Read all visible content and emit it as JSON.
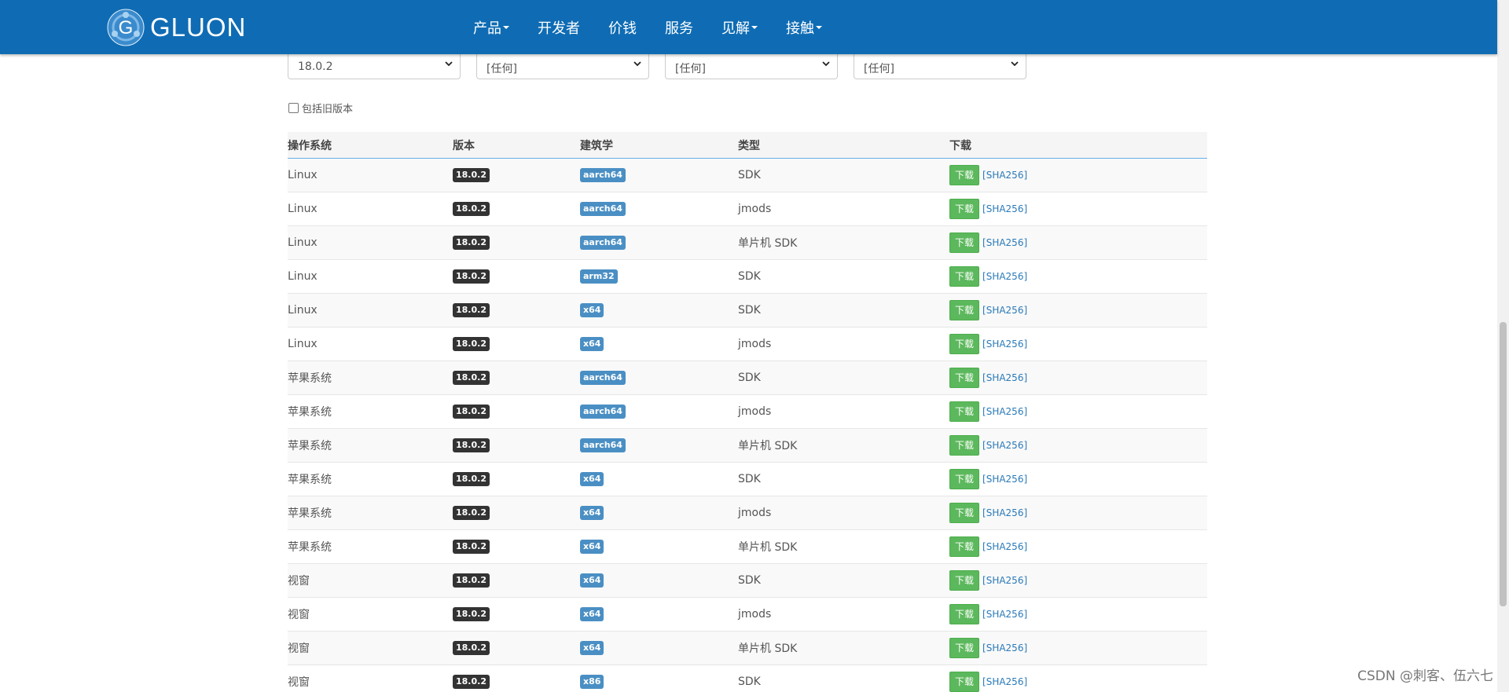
{
  "brand": {
    "name": "GLUON"
  },
  "nav": [
    {
      "label": "产品",
      "dropdown": true
    },
    {
      "label": "开发者",
      "dropdown": false
    },
    {
      "label": "价钱",
      "dropdown": false
    },
    {
      "label": "服务",
      "dropdown": false
    },
    {
      "label": "见解",
      "dropdown": true
    },
    {
      "label": "接触",
      "dropdown": true
    }
  ],
  "filters": {
    "version": "18.0.2",
    "os": "[任何]",
    "arch": "[任何]",
    "type": "[任何]"
  },
  "include_old_label": "包括旧版本",
  "table": {
    "headers": {
      "os": "操作系统",
      "version": "版本",
      "arch": "建筑学",
      "type": "类型",
      "download": "下载"
    },
    "download_label": "下载",
    "sha_label": "[SHA256]",
    "rows": [
      {
        "os": "Linux",
        "version": "18.0.2",
        "arch": "aarch64",
        "type": "SDK"
      },
      {
        "os": "Linux",
        "version": "18.0.2",
        "arch": "aarch64",
        "type": "jmods"
      },
      {
        "os": "Linux",
        "version": "18.0.2",
        "arch": "aarch64",
        "type": "单片机 SDK"
      },
      {
        "os": "Linux",
        "version": "18.0.2",
        "arch": "arm32",
        "type": "SDK"
      },
      {
        "os": "Linux",
        "version": "18.0.2",
        "arch": "x64",
        "type": "SDK"
      },
      {
        "os": "Linux",
        "version": "18.0.2",
        "arch": "x64",
        "type": "jmods"
      },
      {
        "os": "苹果系统",
        "version": "18.0.2",
        "arch": "aarch64",
        "type": "SDK"
      },
      {
        "os": "苹果系统",
        "version": "18.0.2",
        "arch": "aarch64",
        "type": "jmods"
      },
      {
        "os": "苹果系统",
        "version": "18.0.2",
        "arch": "aarch64",
        "type": "单片机 SDK"
      },
      {
        "os": "苹果系统",
        "version": "18.0.2",
        "arch": "x64",
        "type": "SDK"
      },
      {
        "os": "苹果系统",
        "version": "18.0.2",
        "arch": "x64",
        "type": "jmods"
      },
      {
        "os": "苹果系统",
        "version": "18.0.2",
        "arch": "x64",
        "type": "单片机 SDK"
      },
      {
        "os": "视窗",
        "version": "18.0.2",
        "arch": "x64",
        "type": "SDK"
      },
      {
        "os": "视窗",
        "version": "18.0.2",
        "arch": "x64",
        "type": "jmods"
      },
      {
        "os": "视窗",
        "version": "18.0.2",
        "arch": "x64",
        "type": "单片机 SDK"
      },
      {
        "os": "视窗",
        "version": "18.0.2",
        "arch": "x86",
        "type": "SDK"
      }
    ]
  },
  "watermark": "CSDN @刺客、伍六七",
  "colors": {
    "navbar": "#0f6cb4",
    "download_button": "#5cb85c",
    "version_badge": "#333333",
    "arch_badge": "#4a8fc4",
    "link": "#2a7ab8"
  }
}
